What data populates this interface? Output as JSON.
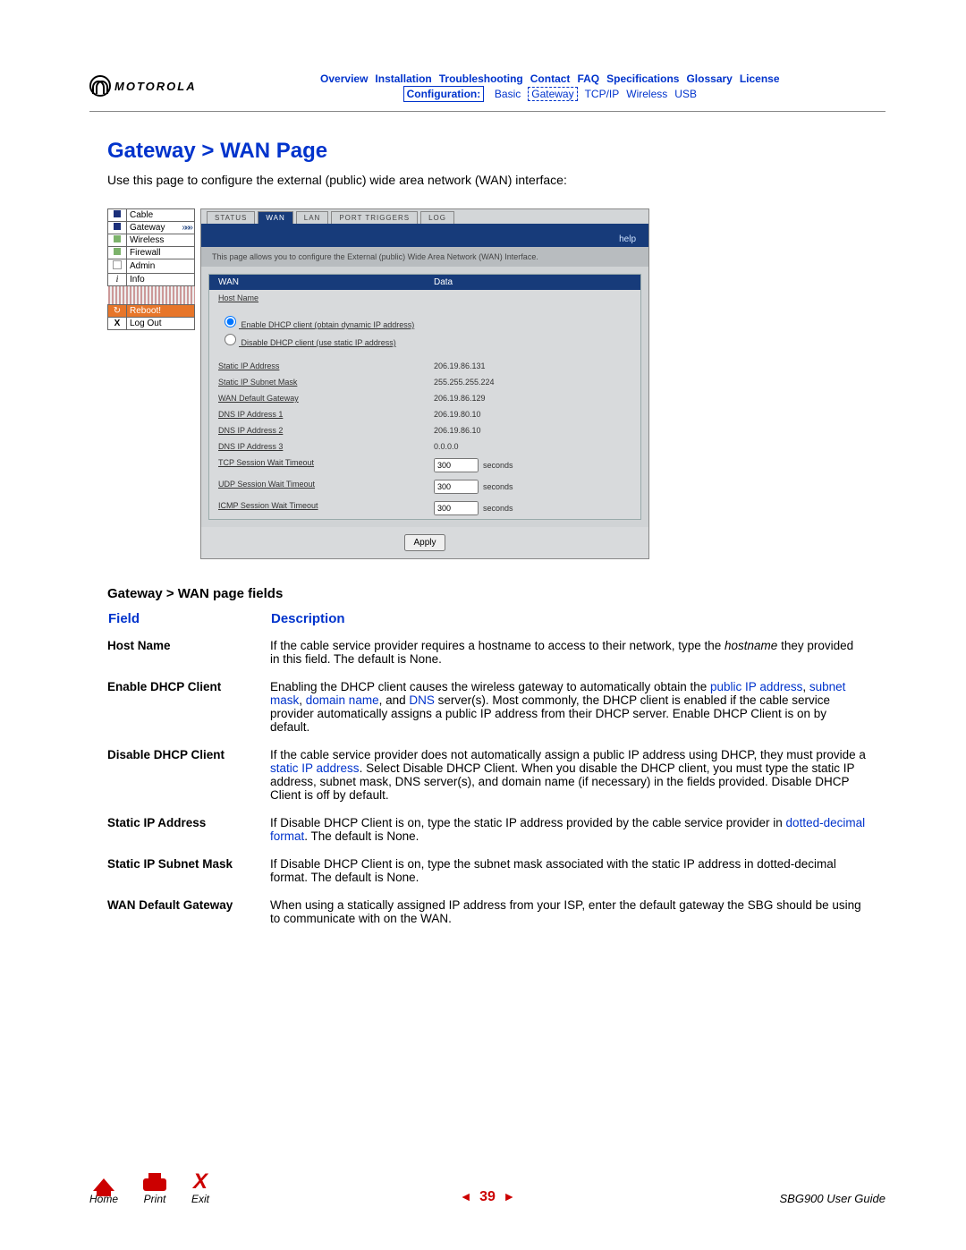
{
  "brand": "MOTOROLA",
  "nav1": [
    "Overview",
    "Installation",
    "Troubleshooting",
    "Contact",
    "FAQ",
    "Specifications",
    "Glossary",
    "License"
  ],
  "nav2": {
    "boxed": "Configuration:",
    "items": [
      "Basic",
      "Gateway",
      "TCP/IP",
      "Wireless",
      "USB"
    ],
    "activeDotted": "Gateway"
  },
  "pageTitle": "Gateway > WAN Page",
  "intro": "Use this page to configure the external (public) wide area network (WAN) interface:",
  "sideNav": {
    "items": [
      {
        "icon": "sq-blue",
        "label": "Cable"
      },
      {
        "icon": "sq-blue",
        "label": "Gateway",
        "arrow": "»»»"
      },
      {
        "icon": "sq-green",
        "label": "Wireless"
      },
      {
        "icon": "sq-green",
        "label": "Firewall"
      },
      {
        "icon": "sq-white",
        "label": "Admin"
      },
      {
        "icon": "sq-i",
        "label": "Info"
      }
    ],
    "reboot": "Reboot!",
    "logout": "Log Out"
  },
  "shot": {
    "tabs": [
      "STATUS",
      "WAN",
      "LAN",
      "PORT TRIGGERS",
      "LOG"
    ],
    "activeTab": "WAN",
    "help": "help",
    "desc": "This page allows you to configure the External (public) Wide Area Network (WAN) Interface.",
    "hdrLeft": "WAN",
    "hdrRight": "Data",
    "hostLabel": "Host Name",
    "radio1": "Enable DHCP client (obtain dynamic IP address)",
    "radio2": "Disable DHCP client (use static IP address)",
    "rows": [
      {
        "l": "Static IP Address",
        "r": "206.19.86.131"
      },
      {
        "l": "Static IP Subnet Mask",
        "r": "255.255.255.224"
      },
      {
        "l": "WAN Default Gateway",
        "r": "206.19.86.129"
      },
      {
        "l": "DNS IP Address 1",
        "r": "206.19.80.10"
      },
      {
        "l": "DNS IP Address 2",
        "r": "206.19.86.10"
      },
      {
        "l": "DNS IP Address 3",
        "r": "0.0.0.0"
      }
    ],
    "timeouts": [
      {
        "l": "TCP Session Wait Timeout",
        "v": "300",
        "u": "seconds"
      },
      {
        "l": "UDP Session Wait Timeout",
        "v": "300",
        "u": "seconds"
      },
      {
        "l": "ICMP Session Wait Timeout",
        "v": "300",
        "u": "seconds"
      }
    ],
    "apply": "Apply"
  },
  "fieldsTitle": "Gateway > WAN page fields",
  "th1": "Field",
  "th2": "Description",
  "fields": [
    {
      "name": "Host Name",
      "desc_pre": "If the cable service provider requires a hostname to access to their network, type the ",
      "desc_ital": "hostname",
      "desc_post": " they provided in this field. The default is None."
    },
    {
      "name": "Enable DHCP Client",
      "desc_pre": "Enabling the DHCP client causes the wireless gateway to automatically obtain the ",
      "links": [
        "public IP address",
        "subnet mask",
        "domain name",
        "DNS"
      ],
      "desc_post": " server(s). Most commonly, the DHCP client is enabled if the cable service provider automatically assigns a public IP address from their DHCP server. Enable DHCP Client is on by default."
    },
    {
      "name": "Disable DHCP Client",
      "desc_pre": "If the cable service provider does not automatically assign a public IP address using DHCP, they must provide a ",
      "link": "static IP address",
      "desc_post": ". Select Disable DHCP Client. When you disable the DHCP client, you must type the static IP address, subnet mask, DNS server(s), and domain name (if necessary) in the fields provided. Disable DHCP Client is off by default."
    },
    {
      "name": "Static IP Address",
      "desc_pre": "If Disable DHCP Client is on, type the static IP address provided by the cable service provider in ",
      "link": "dotted-decimal format",
      "desc_post": ". The default is None."
    },
    {
      "name": "Static IP Subnet Mask",
      "desc": "If Disable DHCP Client is on, type the subnet mask associated with the static IP address in dotted-decimal format. The default is None."
    },
    {
      "name": "WAN Default Gateway",
      "desc": "When using a statically assigned IP address from your ISP, enter the default gateway the SBG should be using to communicate with on the WAN."
    }
  ],
  "footer": {
    "home": "Home",
    "print": "Print",
    "exit": "Exit",
    "page": "39",
    "guide": "SBG900 User Guide"
  }
}
